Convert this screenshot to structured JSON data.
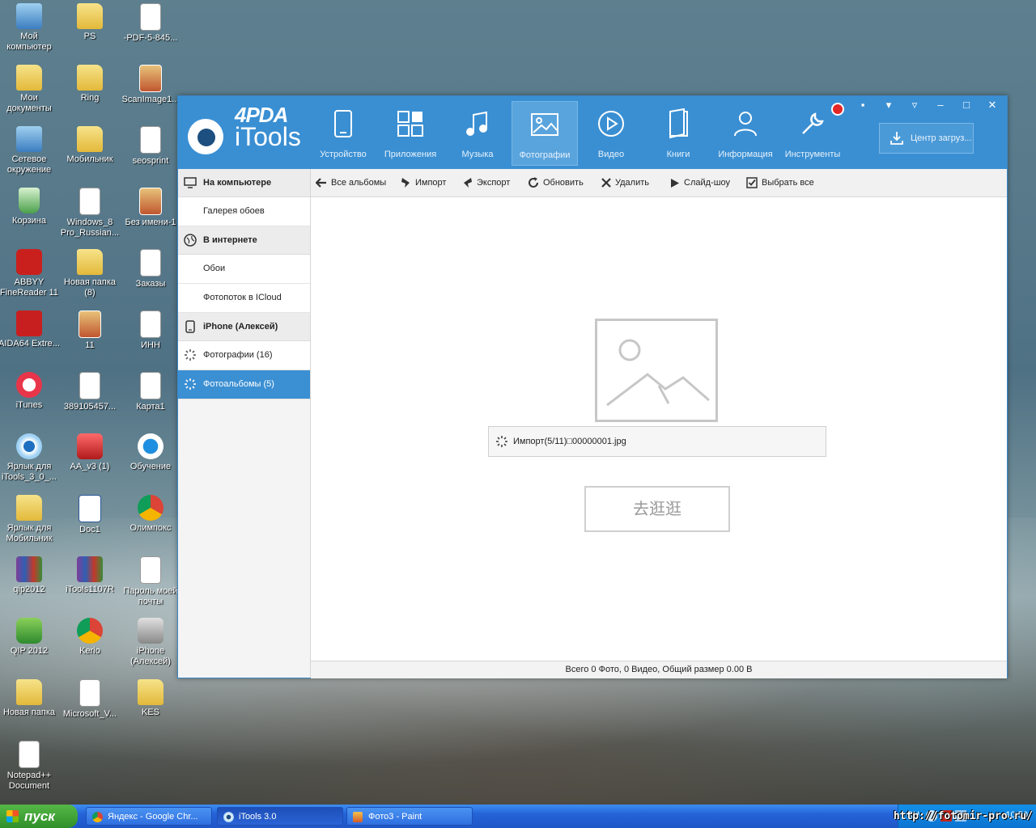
{
  "desktop": {
    "icons": [
      {
        "label": "Мой компьютер",
        "icon": "computer-icon"
      },
      {
        "label": "PS",
        "icon": "folder-icon"
      },
      {
        "label": "-PDF-5-845...",
        "icon": "document-icon"
      },
      {
        "label": "Мои документы",
        "icon": "folder-icon"
      },
      {
        "label": "Ring",
        "icon": "folder-icon"
      },
      {
        "label": "ScanImage1...",
        "icon": "image-icon"
      },
      {
        "label": "Сетевое окружение",
        "icon": "network-icon"
      },
      {
        "label": "Мобильник",
        "icon": "folder-icon"
      },
      {
        "label": "seosprint",
        "icon": "notepad-icon"
      },
      {
        "label": "Корзина",
        "icon": "recycle-bin-icon"
      },
      {
        "label": "Windows_8 Pro_Russian...",
        "icon": "document-icon"
      },
      {
        "label": "Без имени-1",
        "icon": "image-icon"
      },
      {
        "label": "ABBYY FineReader 11",
        "icon": "abbyy-icon"
      },
      {
        "label": "Новая папка (8)",
        "icon": "folder-icon"
      },
      {
        "label": "Заказы",
        "icon": "notepad-icon"
      },
      {
        "label": "AIDA64 Extre...",
        "icon": "aida64-icon"
      },
      {
        "label": "11",
        "icon": "image-icon"
      },
      {
        "label": "ИНН",
        "icon": "notepad-icon"
      },
      {
        "label": "iTunes",
        "icon": "itunes-icon"
      },
      {
        "label": "389105457...",
        "icon": "document-icon"
      },
      {
        "label": "Карта1",
        "icon": "document-icon"
      },
      {
        "label": "Ярлык для iTools_3_0_...",
        "icon": "itools-icon"
      },
      {
        "label": "AA_v3 (1)",
        "icon": "ammyy-icon"
      },
      {
        "label": "Обучение",
        "icon": "globe-icon"
      },
      {
        "label": "Ярлык для Мобильник",
        "icon": "folder-icon"
      },
      {
        "label": "Doc1",
        "icon": "word-icon"
      },
      {
        "label": "Олимпокс",
        "icon": "chrome-icon"
      },
      {
        "label": "qip2012",
        "icon": "winrar-icon"
      },
      {
        "label": "iTools1107R",
        "icon": "winrar-icon"
      },
      {
        "label": "Пароль моей почты",
        "icon": "notepad-icon"
      },
      {
        "label": "QIP 2012",
        "icon": "qip-icon"
      },
      {
        "label": "Kerio",
        "icon": "chrome-icon"
      },
      {
        "label": "iPhone (Алексей)",
        "icon": "camera-icon"
      },
      {
        "label": "Новая папка",
        "icon": "folder-icon"
      },
      {
        "label": "Microsoft_V...",
        "icon": "document-icon"
      },
      {
        "label": "KES",
        "icon": "folder-icon"
      },
      {
        "label": "Notepad++ Document",
        "icon": "notepad-icon"
      }
    ]
  },
  "window": {
    "logo_top": "4PDA",
    "logo_name": "iTools",
    "nav": [
      {
        "label": "Устройство",
        "icon": "phone-icon"
      },
      {
        "label": "Приложения",
        "icon": "apps-icon"
      },
      {
        "label": "Музыка",
        "icon": "music-icon"
      },
      {
        "label": "Фотографии",
        "icon": "photo-icon"
      },
      {
        "label": "Видео",
        "icon": "video-icon"
      },
      {
        "label": "Книги",
        "icon": "book-icon"
      },
      {
        "label": "Информация",
        "icon": "person-icon"
      },
      {
        "label": "Инструменты",
        "icon": "tools-icon"
      }
    ],
    "active_nav": "Фотографии",
    "download_center": "Центр загруз...",
    "sidebar": {
      "group_computer": "На компьютере",
      "wallpaper_gallery": "Галерея обоев",
      "group_internet": "В интернете",
      "wallpapers": "Обои",
      "photostream": "Фотопоток в ICloud",
      "group_device": "iPhone (Алексей)",
      "photos": "Фотографии (16)",
      "photo_albums": "Фотоальбомы (5)"
    },
    "toolbar": {
      "all_albums": "Все альбомы",
      "import": "Импорт",
      "export": "Экспорт",
      "refresh": "Обновить",
      "delete": "Удалить",
      "slideshow": "Слайд-шоу",
      "select_all": "Выбрать все"
    },
    "progress_text": "Импорт(5/11)□00000001.jpg",
    "browse_button": "去逛逛",
    "status": "Всего 0 Фото, 0 Видео, Общий размер 0.00 B"
  },
  "taskbar": {
    "start": "пуск",
    "tasks": [
      {
        "label": "Яндекс - Google Chr..."
      },
      {
        "label": "iTools 3.0"
      },
      {
        "label": "Фото3 - Paint"
      }
    ],
    "tray_lang": "RU",
    "tray_time": "10:50"
  },
  "watermark": "http://fotomir-pro.ru/"
}
